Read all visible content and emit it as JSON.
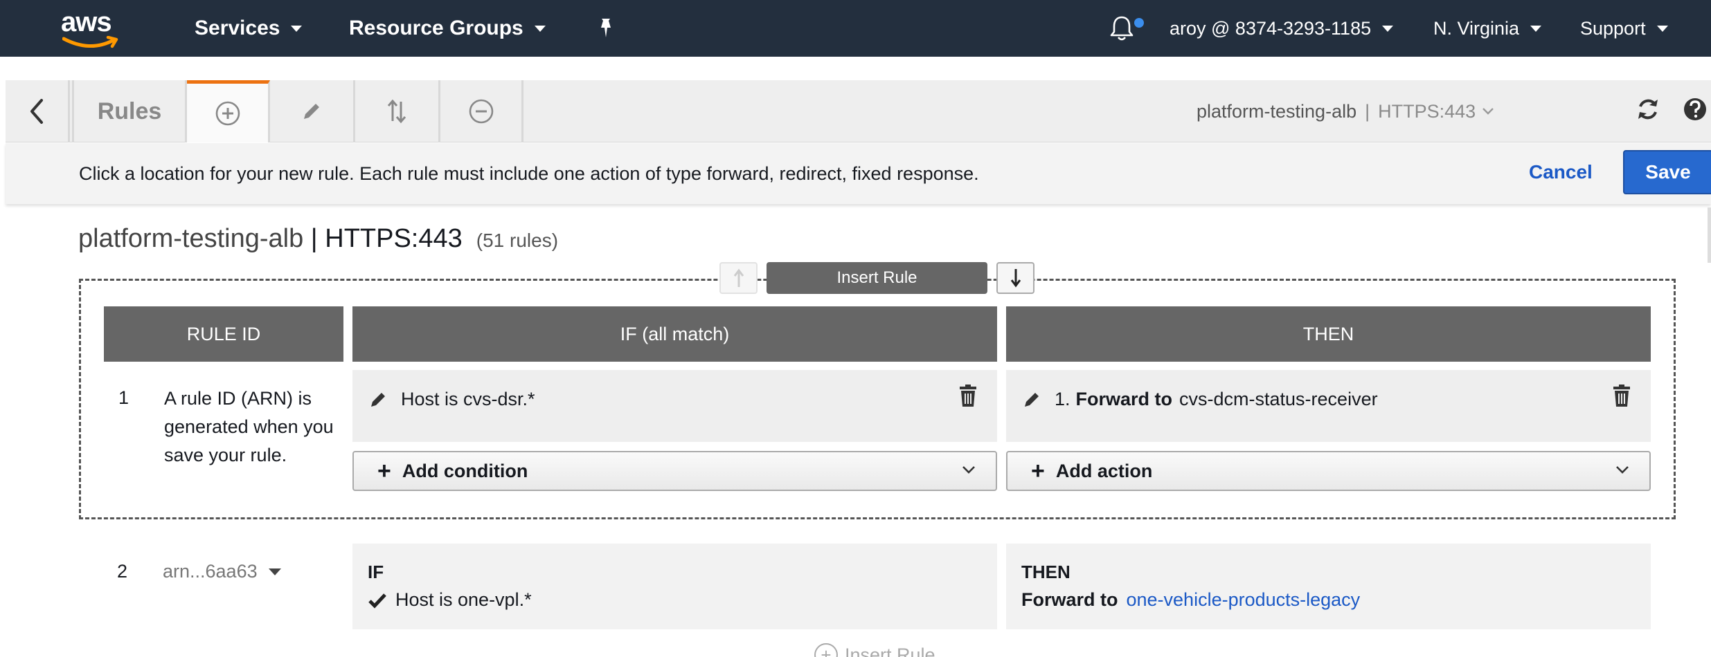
{
  "topnav": {
    "logo_text": "aws",
    "services": "Services",
    "resource_groups": "Resource Groups",
    "user": "aroy @ 8374-3293-1185",
    "region": "N. Virginia",
    "support": "Support"
  },
  "toolbar": {
    "rules_label": "Rules",
    "listener_name": "platform-testing-alb",
    "separator": "|",
    "listener_port": "HTTPS:443"
  },
  "infobar": {
    "message": "Click a location for your new rule. Each rule must include one action of type forward, redirect, fixed response.",
    "cancel_label": "Cancel",
    "save_label": "Save"
  },
  "listener_title": {
    "name": "platform-testing-alb",
    "separator": " | ",
    "port": "HTTPS:443",
    "count": "(51 rules)"
  },
  "insert_rule": {
    "label": "Insert Rule"
  },
  "columns": {
    "rule_id": "RULE ID",
    "if": "IF (all match)",
    "then": "THEN"
  },
  "new_rule": {
    "number": "1",
    "id_text": "A rule ID (ARN) is generated when you save your rule.",
    "condition": "Host is cvs-dsr.*",
    "action_prefix": "1.",
    "action_verb": "Forward to",
    "action_target": "cvs-dcm-status-receiver",
    "add_condition": "Add condition",
    "add_action": "Add action"
  },
  "rule_2": {
    "number": "2",
    "arn": "arn...6aa63",
    "if_head": "IF",
    "condition": "Host is one-vpl.*",
    "then_head": "THEN",
    "action_verb": "Forward to",
    "action_target": "one-vehicle-products-legacy"
  },
  "insert_rule_bottom": "Insert Rule",
  "colors": {
    "nav_bg": "#232f3e",
    "accent_orange": "#ec7211",
    "primary_blue": "#2769cf",
    "link_blue": "#1b59c6",
    "header_gray": "#666666"
  }
}
